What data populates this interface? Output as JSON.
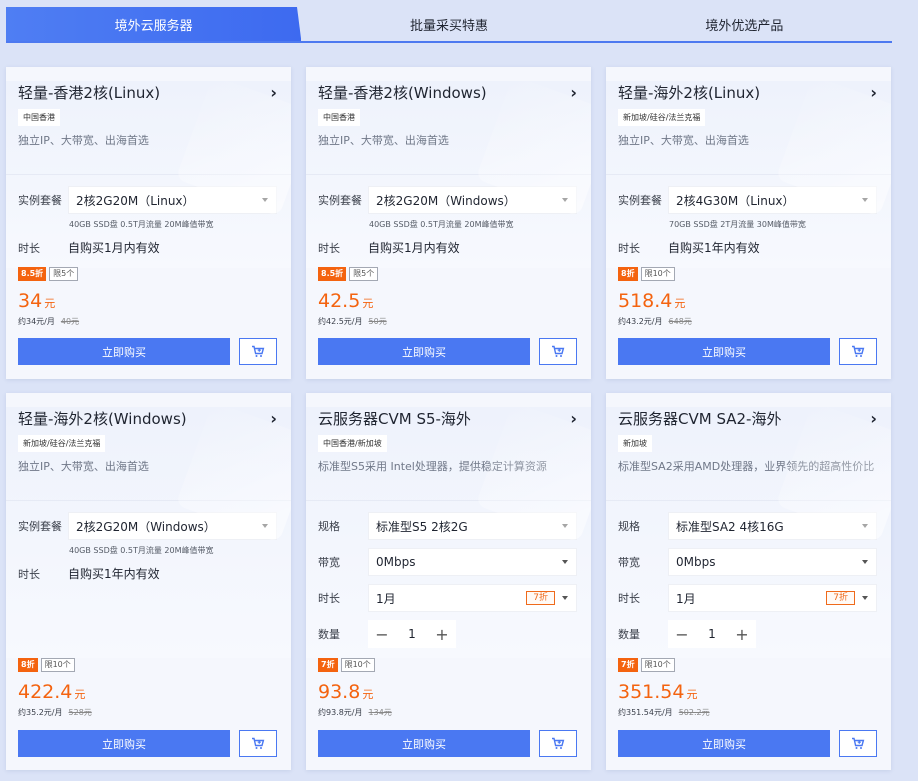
{
  "tabs": [
    {
      "label": "境外云服务器",
      "active": true
    },
    {
      "label": "批量采买特惠",
      "active": false
    },
    {
      "label": "境外优选产品",
      "active": false
    }
  ],
  "common": {
    "buy_label": "立即购买",
    "price_unit": "元",
    "instance_label": "实例套餐",
    "duration_label": "时长",
    "spec_label": "规格",
    "bandwidth_label": "带宽",
    "quantity_label": "数量",
    "light_desc": "独立IP、大带宽、出海首选"
  },
  "cards": [
    {
      "title": "轻量-香港2核(Linux)",
      "region": "中国香港",
      "desc": "独立IP、大带宽、出海首选",
      "instance": "2核2G20M（Linux）",
      "spec": "40GB SSD盘 0.5T月流量 20M峰值带宽",
      "duration": "自购买1月内有效",
      "discount": "8.5折",
      "limit": "限5个",
      "price": "34",
      "monthly": "约34元/月",
      "original": "40元"
    },
    {
      "title": "轻量-香港2核(Windows)",
      "region": "中国香港",
      "desc": "独立IP、大带宽、出海首选",
      "instance": "2核2G20M（Windows）",
      "spec": "40GB SSD盘 0.5T月流量 20M峰值带宽",
      "duration": "自购买1月内有效",
      "discount": "8.5折",
      "limit": "限5个",
      "price": "42.5",
      "monthly": "约42.5元/月",
      "original": "50元"
    },
    {
      "title": "轻量-海外2核(Linux)",
      "region": "新加坡/硅谷/法兰克福",
      "desc": "独立IP、大带宽、出海首选",
      "instance": "2核4G30M（Linux）",
      "spec": "70GB SSD盘 2T月流量 30M峰值带宽",
      "duration": "自购买1年内有效",
      "discount": "8折",
      "limit": "限10个",
      "price": "518.4",
      "monthly": "约43.2元/月",
      "original": "648元"
    },
    {
      "title": "轻量-海外2核(Windows)",
      "region": "新加坡/硅谷/法兰克福",
      "desc": "独立IP、大带宽、出海首选",
      "instance": "2核2G20M（Windows）",
      "spec": "40GB SSD盘 0.5T月流量 20M峰值带宽",
      "duration": "自购买1年内有效",
      "discount": "8折",
      "limit": "限10个",
      "price": "422.4",
      "monthly": "约35.2元/月",
      "original": "528元"
    },
    {
      "title": "云服务器CVM S5-海外",
      "region": "中国香港/新加坡",
      "desc": "标准型S5采用 Intel处理器，提供稳定计算资源",
      "spec_value": "标准型S5 2核2G",
      "bandwidth": "0Mbps",
      "duration_select": "1月",
      "duration_discount": "7折",
      "quantity": "1",
      "discount": "7折",
      "limit": "限10个",
      "price": "93.8",
      "monthly": "约93.8元/月",
      "original": "134元"
    },
    {
      "title": "云服务器CVM SA2-海外",
      "region": "新加坡",
      "desc": "标准型SA2采用AMD处理器，业界领先的超高性价比",
      "spec_value": "标准型SA2 4核16G",
      "bandwidth": "0Mbps",
      "duration_select": "1月",
      "duration_discount": "7折",
      "quantity": "1",
      "discount": "7折",
      "limit": "限10个",
      "price": "351.54",
      "monthly": "约351.54元/月",
      "original": "502.2元"
    }
  ],
  "stepper": {
    "minus": "−",
    "plus": "+"
  },
  "icons": {
    "chevron": "chevron-right-icon",
    "cart": "cart-icon",
    "caret": "caret-down-icon"
  },
  "colors": {
    "accent": "#4a78f2",
    "price": "#f4630f",
    "background": "#dbe3f7"
  }
}
